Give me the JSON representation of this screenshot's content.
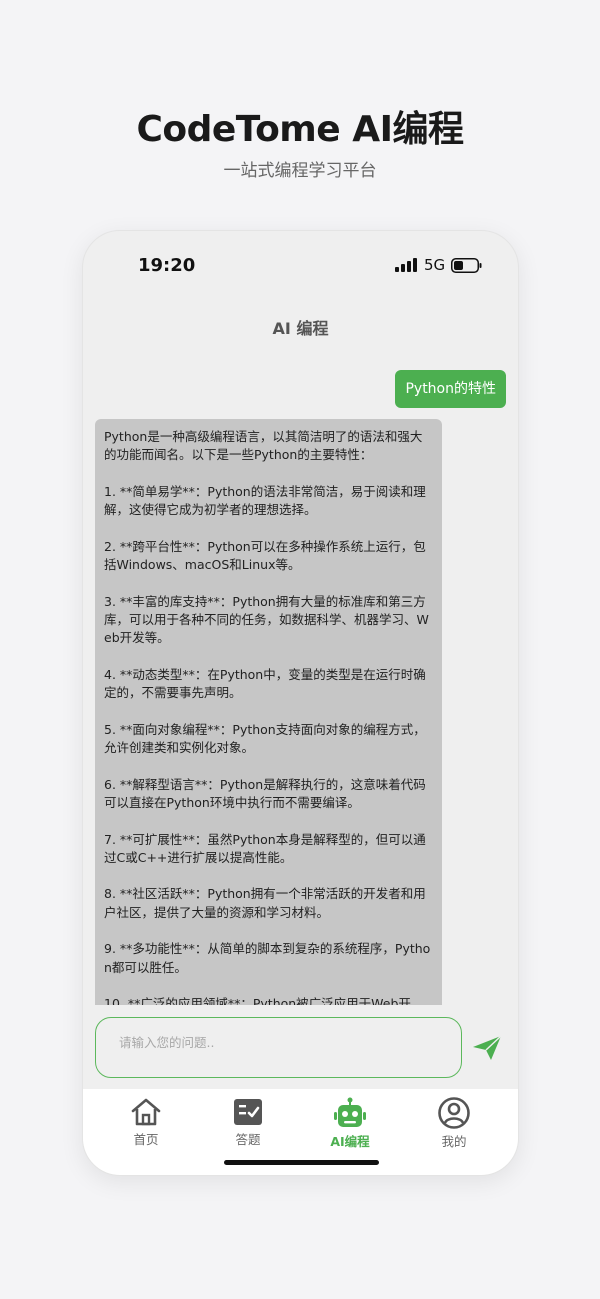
{
  "promo": {
    "title": "CodeTome AI编程",
    "subtitle": "一站式编程学习平台"
  },
  "status_bar": {
    "time": "19:20",
    "network": "5G"
  },
  "nav": {
    "title": "AI 编程"
  },
  "chat": {
    "user_message": "Python的特性",
    "ai_message": "Python是一种高级编程语言，以其简洁明了的语法和强大的功能而闻名。以下是一些Python的主要特性：\n\n1. **简单易学**：Python的语法非常简洁，易于阅读和理解，这使得它成为初学者的理想选择。\n\n2. **跨平台性**：Python可以在多种操作系统上运行，包括Windows、macOS和Linux等。\n\n3. **丰富的库支持**：Python拥有大量的标准库和第三方库，可以用于各种不同的任务，如数据科学、机器学习、Web开发等。\n\n4. **动态类型**：在Python中，变量的类型是在运行时确定的，不需要事先声明。\n\n5. **面向对象编程**：Python支持面向对象的编程方式，允许创建类和实例化对象。\n\n6. **解释型语言**：Python是解释执行的，这意味着代码可以直接在Python环境中执行而不需要编译。\n\n7. **可扩展性**：虽然Python本身是解释型的，但可以通过C或C++进行扩展以提高性能。\n\n8. **社区活跃**：Python拥有一个非常活跃的开发者和用户社区，提供了大量的资源和学习材料。\n\n9. **多功能性**：从简单的脚本到复杂的系统程序，Python都可以胜任。\n\n10. **广泛的应用领域**：Python被广泛应用于Web开"
  },
  "input": {
    "placeholder": "请输入您的问题.."
  },
  "tabs": [
    {
      "label": "首页",
      "icon": "home-icon",
      "active": false
    },
    {
      "label": "答题",
      "icon": "quiz-icon",
      "active": false
    },
    {
      "label": "AI编程",
      "icon": "robot-icon",
      "active": true
    },
    {
      "label": "我的",
      "icon": "profile-icon",
      "active": false
    }
  ],
  "colors": {
    "accent": "#4caf50",
    "ai_bubble": "#c6c6c6",
    "phone_bg": "#efefef",
    "page_bg": "#f4f4f6"
  }
}
